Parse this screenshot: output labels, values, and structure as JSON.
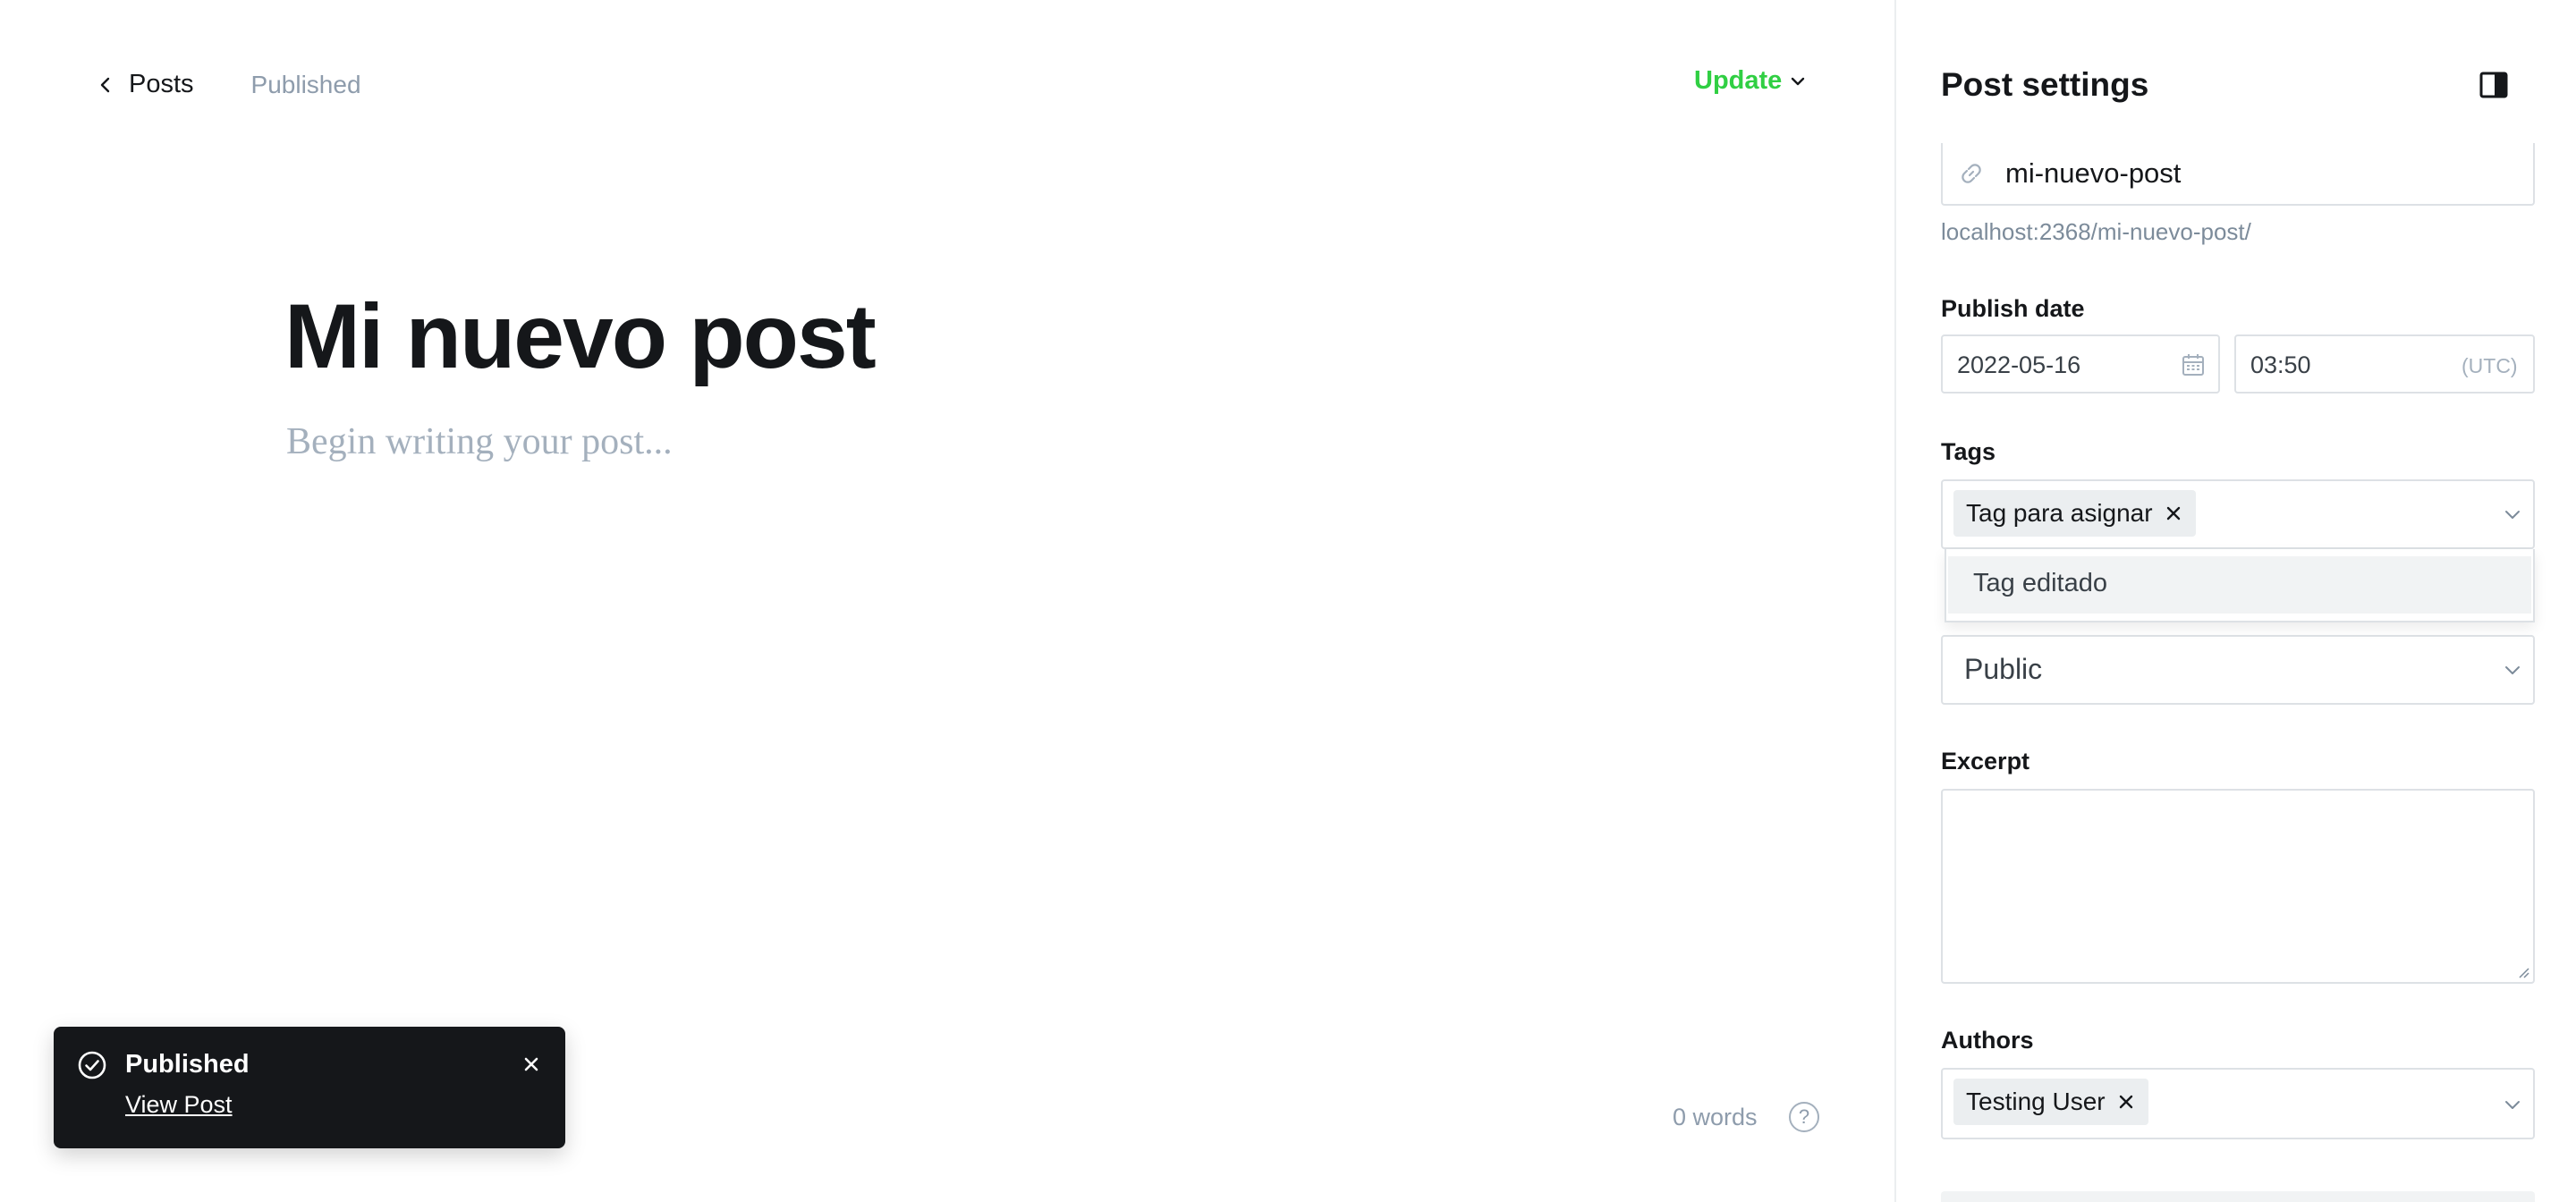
{
  "header": {
    "back_label": "Posts",
    "status": "Published",
    "update_label": "Update"
  },
  "post": {
    "title": "Mi nuevo post",
    "body_placeholder": "Begin writing your post..."
  },
  "footer": {
    "word_count": "0 words",
    "help_glyph": "?"
  },
  "toast": {
    "title": "Published",
    "link": "View Post"
  },
  "sidebar": {
    "title": "Post settings",
    "url": {
      "slug": "mi-nuevo-post",
      "hint": "localhost:2368/mi-nuevo-post/"
    },
    "publish_date": {
      "label": "Publish date",
      "date": "2022-05-16",
      "time": "03:50",
      "timezone": "(UTC)"
    },
    "tags": {
      "label": "Tags",
      "selected": [
        "Tag para asignar"
      ],
      "dropdown_options": [
        "Tag editado"
      ]
    },
    "visibility": {
      "value": "Public"
    },
    "excerpt": {
      "label": "Excerpt",
      "value": ""
    },
    "authors": {
      "label": "Authors",
      "selected": [
        "Testing User"
      ]
    }
  },
  "colors": {
    "accent_green": "#30cf43",
    "toast_bg": "#15171a",
    "muted_text": "#8e9cac"
  },
  "icons": {
    "back": "chevron-left-icon",
    "update": "chevron-down-icon",
    "sidebar_toggle": "sidebar-toggle-icon",
    "url": "link-icon",
    "date": "calendar-icon",
    "toast": "check-circle-icon",
    "toast_close": "close-icon",
    "help": "help-icon"
  }
}
